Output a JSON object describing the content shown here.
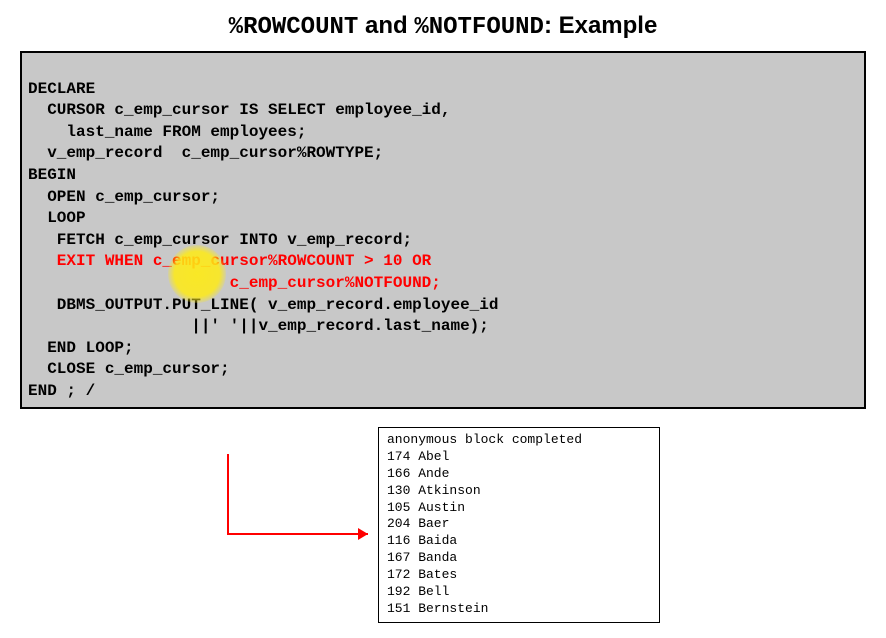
{
  "title": {
    "part1": "%ROWCOUNT",
    "conj": " and ",
    "part2": "%NOTFOUND",
    "suffix": ": Example"
  },
  "code": {
    "l1": "DECLARE",
    "l2": "  CURSOR c_emp_cursor IS SELECT employee_id,",
    "l3": "    last_name FROM employees;",
    "l4": "  v_emp_record  c_emp_cursor%ROWTYPE;",
    "l5": "BEGIN",
    "l6": "  OPEN c_emp_cursor;",
    "l7": "  LOOP",
    "l8": "   FETCH c_emp_cursor INTO v_emp_record;",
    "l9": "   EXIT WHEN c_emp_cursor%ROWCOUNT > 10 OR",
    "l10": "                     c_emp_cursor%NOTFOUND;",
    "l11": "   DBMS_OUTPUT.PUT_LINE( v_emp_record.employee_id",
    "l12": "                 ||' '||v_emp_record.last_name);",
    "l13": "  END LOOP;",
    "l14": "  CLOSE c_emp_cursor;",
    "l15": "END ; /"
  },
  "output": {
    "header": "anonymous block completed",
    "rows": [
      "174 Abel",
      "166 Ande",
      "130 Atkinson",
      "105 Austin",
      "204 Baer",
      "116 Baida",
      "167 Banda",
      "172 Bates",
      "192 Bell",
      "151 Bernstein"
    ]
  }
}
